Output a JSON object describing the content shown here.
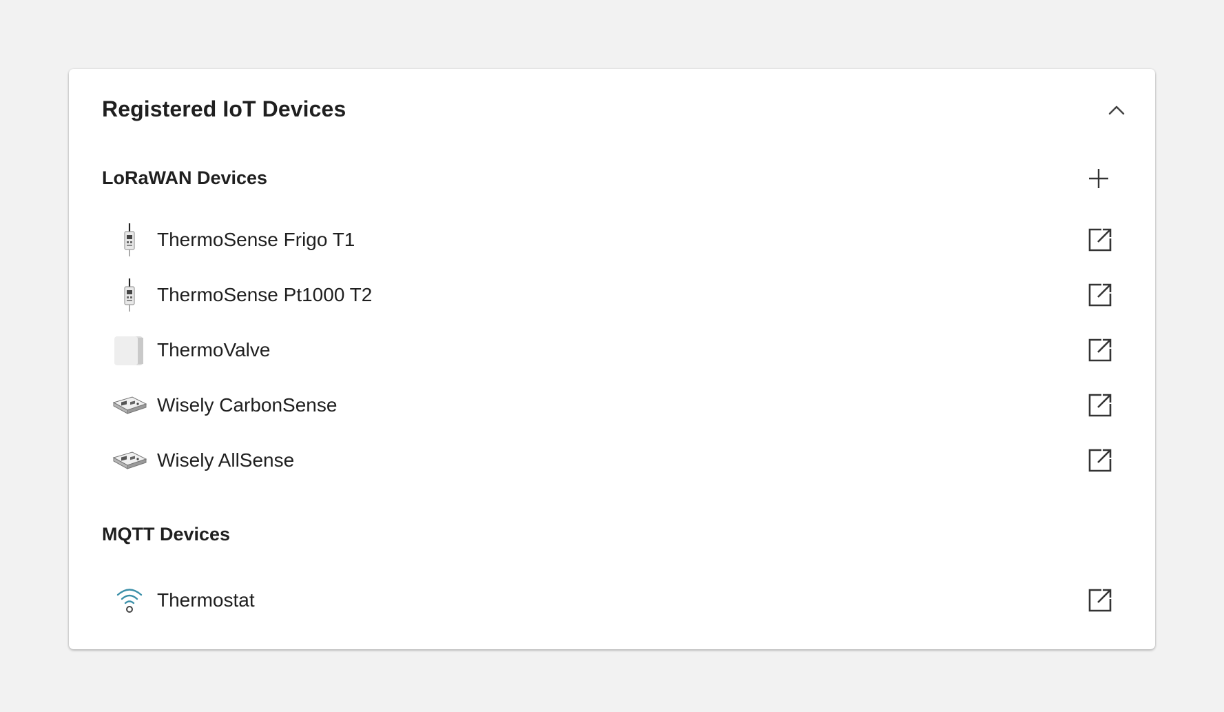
{
  "card": {
    "title": "Registered IoT Devices",
    "collapse_icon": "chevron-up-icon"
  },
  "lorawan": {
    "title": "LoRaWAN Devices",
    "add_icon": "plus-icon",
    "devices": [
      {
        "name": "ThermoSense Frigo T1",
        "icon": "antenna-sensor-icon",
        "action_icon": "open-in-new-icon"
      },
      {
        "name": "ThermoSense Pt1000 T2",
        "icon": "antenna-sensor-icon",
        "action_icon": "open-in-new-icon"
      },
      {
        "name": "ThermoValve",
        "icon": "valve-cube-icon",
        "action_icon": "open-in-new-icon"
      },
      {
        "name": "Wisely CarbonSense",
        "icon": "flat-sensor-icon",
        "action_icon": "open-in-new-icon"
      },
      {
        "name": "Wisely AllSense",
        "icon": "flat-sensor-icon",
        "action_icon": "open-in-new-icon"
      }
    ]
  },
  "mqtt": {
    "title": "MQTT Devices",
    "devices": [
      {
        "name": "Thermostat",
        "icon": "wifi-signal-icon",
        "action_icon": "open-in-new-icon"
      }
    ]
  },
  "colors": {
    "background": "#f2f2f2",
    "card": "#ffffff",
    "text": "#1f1f1f",
    "icon_stroke": "#333333",
    "wifi_accent": "#3a8fa8"
  }
}
